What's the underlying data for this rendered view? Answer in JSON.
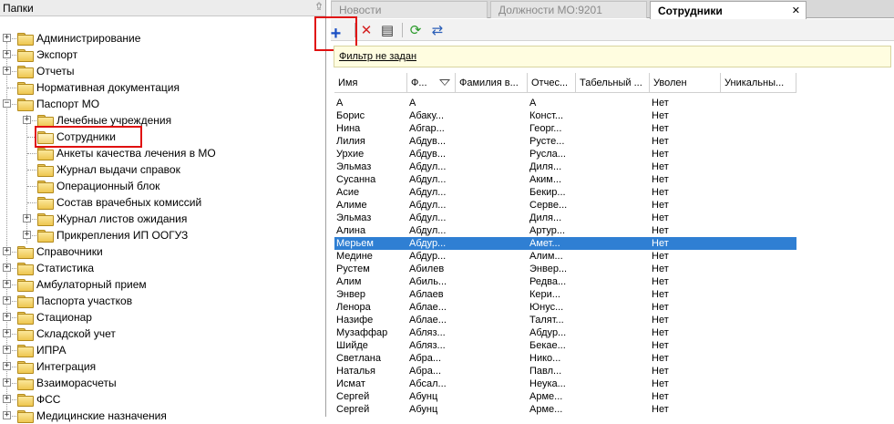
{
  "left_panel": {
    "title": "Папки",
    "pin_icon": "pin-icon",
    "tree": [
      {
        "label": "Администрирование",
        "level": 0,
        "expandable": true
      },
      {
        "label": "Экспорт",
        "level": 0,
        "expandable": true
      },
      {
        "label": "Отчеты",
        "level": 0,
        "expandable": true
      },
      {
        "label": "Нормативная документация",
        "level": 0,
        "expandable": false
      },
      {
        "label": "Паспорт МО",
        "level": 0,
        "expandable": true,
        "expanded": true
      },
      {
        "label": "Лечебные учреждения",
        "level": 1,
        "expandable": true
      },
      {
        "label": "Сотрудники",
        "level": 1,
        "expandable": false,
        "selected": true,
        "highlighted": true
      },
      {
        "label": "Анкеты качества лечения в МО",
        "level": 1,
        "expandable": false
      },
      {
        "label": "Журнал выдачи справок",
        "level": 1,
        "expandable": false
      },
      {
        "label": "Операционный блок",
        "level": 1,
        "expandable": false
      },
      {
        "label": "Состав врачебных комиссий",
        "level": 1,
        "expandable": false
      },
      {
        "label": "Журнал листов ожидания",
        "level": 1,
        "expandable": true
      },
      {
        "label": "Прикрепления ИП ООГУЗ",
        "level": 1,
        "expandable": true
      },
      {
        "label": "Справочники",
        "level": 0,
        "expandable": true
      },
      {
        "label": "Статистика",
        "level": 0,
        "expandable": true
      },
      {
        "label": "Амбулаторный прием",
        "level": 0,
        "expandable": true
      },
      {
        "label": "Паспорта участков",
        "level": 0,
        "expandable": true
      },
      {
        "label": "Стационар",
        "level": 0,
        "expandable": true
      },
      {
        "label": "Складской учет",
        "level": 0,
        "expandable": true
      },
      {
        "label": "ИПРА",
        "level": 0,
        "expandable": true
      },
      {
        "label": "Интеграция",
        "level": 0,
        "expandable": true
      },
      {
        "label": "Взаиморасчеты",
        "level": 0,
        "expandable": true
      },
      {
        "label": "ФСС",
        "level": 0,
        "expandable": true
      },
      {
        "label": "Медицинские назначения",
        "level": 0,
        "expandable": true
      }
    ]
  },
  "tabs": [
    {
      "label": "Новости",
      "active": false
    },
    {
      "label": "Должности МО:9201",
      "active": false
    },
    {
      "label": "Сотрудники",
      "active": true,
      "close_icon": "close-icon"
    }
  ],
  "toolbar": {
    "buttons": [
      {
        "name": "add-button",
        "icon": "plus-icon",
        "glyph": "+",
        "color": "#1a4fc4",
        "highlighted": true
      },
      {
        "name": "delete-button",
        "icon": "delete-icon",
        "glyph": "✕",
        "color": "#d42020"
      },
      {
        "name": "properties-button",
        "icon": "properties-icon",
        "glyph": "▤",
        "color": "#333333"
      },
      {
        "name": "refresh-button",
        "icon": "refresh-icon",
        "glyph": "⟳",
        "color": "#2a9a2a"
      },
      {
        "name": "export-button",
        "icon": "export-icon",
        "glyph": "⇄",
        "color": "#2b5fb8"
      }
    ]
  },
  "filter": {
    "text": "Фильтр не задан"
  },
  "grid": {
    "columns": [
      "Имя",
      "Ф...",
      "Фамилия в...",
      "Отчес...",
      "Табельный ...",
      "Уволен",
      "Уникальны..."
    ],
    "sort_column": 1,
    "selected_row": 11,
    "rows": [
      [
        "А",
        "А",
        "",
        "А",
        "",
        "Нет",
        ""
      ],
      [
        "Борис",
        "Абаку...",
        "",
        "Конст...",
        "",
        "Нет",
        ""
      ],
      [
        "Нина",
        "Абгар...",
        "",
        "Георг...",
        "",
        "Нет",
        ""
      ],
      [
        "Лилия",
        "Абдув...",
        "",
        "Русте...",
        "",
        "Нет",
        ""
      ],
      [
        "Урхие",
        "Абдув...",
        "",
        "Русла...",
        "",
        "Нет",
        ""
      ],
      [
        "Эльмаз",
        "Абдул...",
        "",
        "Диля...",
        "",
        "Нет",
        ""
      ],
      [
        "Сусанна",
        "Абдул...",
        "",
        "Аким...",
        "",
        "Нет",
        ""
      ],
      [
        "Асие",
        "Абдул...",
        "",
        "Бекир...",
        "",
        "Нет",
        ""
      ],
      [
        "Алиме",
        "Абдул...",
        "",
        "Серве...",
        "",
        "Нет",
        ""
      ],
      [
        "Эльмаз",
        "Абдул...",
        "",
        "Диля...",
        "",
        "Нет",
        ""
      ],
      [
        "Алина",
        "Абдул...",
        "",
        "Артур...",
        "",
        "Нет",
        ""
      ],
      [
        "Мерьем",
        "Абдур...",
        "",
        "Амет...",
        "",
        "Нет",
        ""
      ],
      [
        "Медине",
        "Абдур...",
        "",
        "Алим...",
        "",
        "Нет",
        ""
      ],
      [
        "Рустем",
        "Абилев",
        "",
        "Энвер...",
        "",
        "Нет",
        ""
      ],
      [
        "Алим",
        "Абиль...",
        "",
        "Редва...",
        "",
        "Нет",
        ""
      ],
      [
        "Энвер",
        "Аблаев",
        "",
        "Кери...",
        "",
        "Нет",
        ""
      ],
      [
        "Ленора",
        "Аблае...",
        "",
        "Юнус...",
        "",
        "Нет",
        ""
      ],
      [
        "Назифе",
        "Аблае...",
        "",
        "Талят...",
        "",
        "Нет",
        ""
      ],
      [
        "Музаффар",
        "Абляз...",
        "",
        "Абдур...",
        "",
        "Нет",
        ""
      ],
      [
        "Шийде",
        "Абляз...",
        "",
        "Бекае...",
        "",
        "Нет",
        ""
      ],
      [
        "Светлана",
        "Абра...",
        "",
        "Нико...",
        "",
        "Нет",
        ""
      ],
      [
        "Наталья",
        "Абра...",
        "",
        "Павл...",
        "",
        "Нет",
        ""
      ],
      [
        "Исмат",
        "Абсал...",
        "",
        "Неука...",
        "",
        "Нет",
        ""
      ],
      [
        "Сергей",
        "Абунц",
        "",
        "Арме...",
        "",
        "Нет",
        ""
      ],
      [
        "Сергей",
        "Абунц",
        "",
        "Арме...",
        "",
        "Нет",
        ""
      ]
    ]
  },
  "colors": {
    "selection": "#2f7fd3",
    "highlight_box": "#e01010",
    "filter_bg": "#fffde0"
  }
}
